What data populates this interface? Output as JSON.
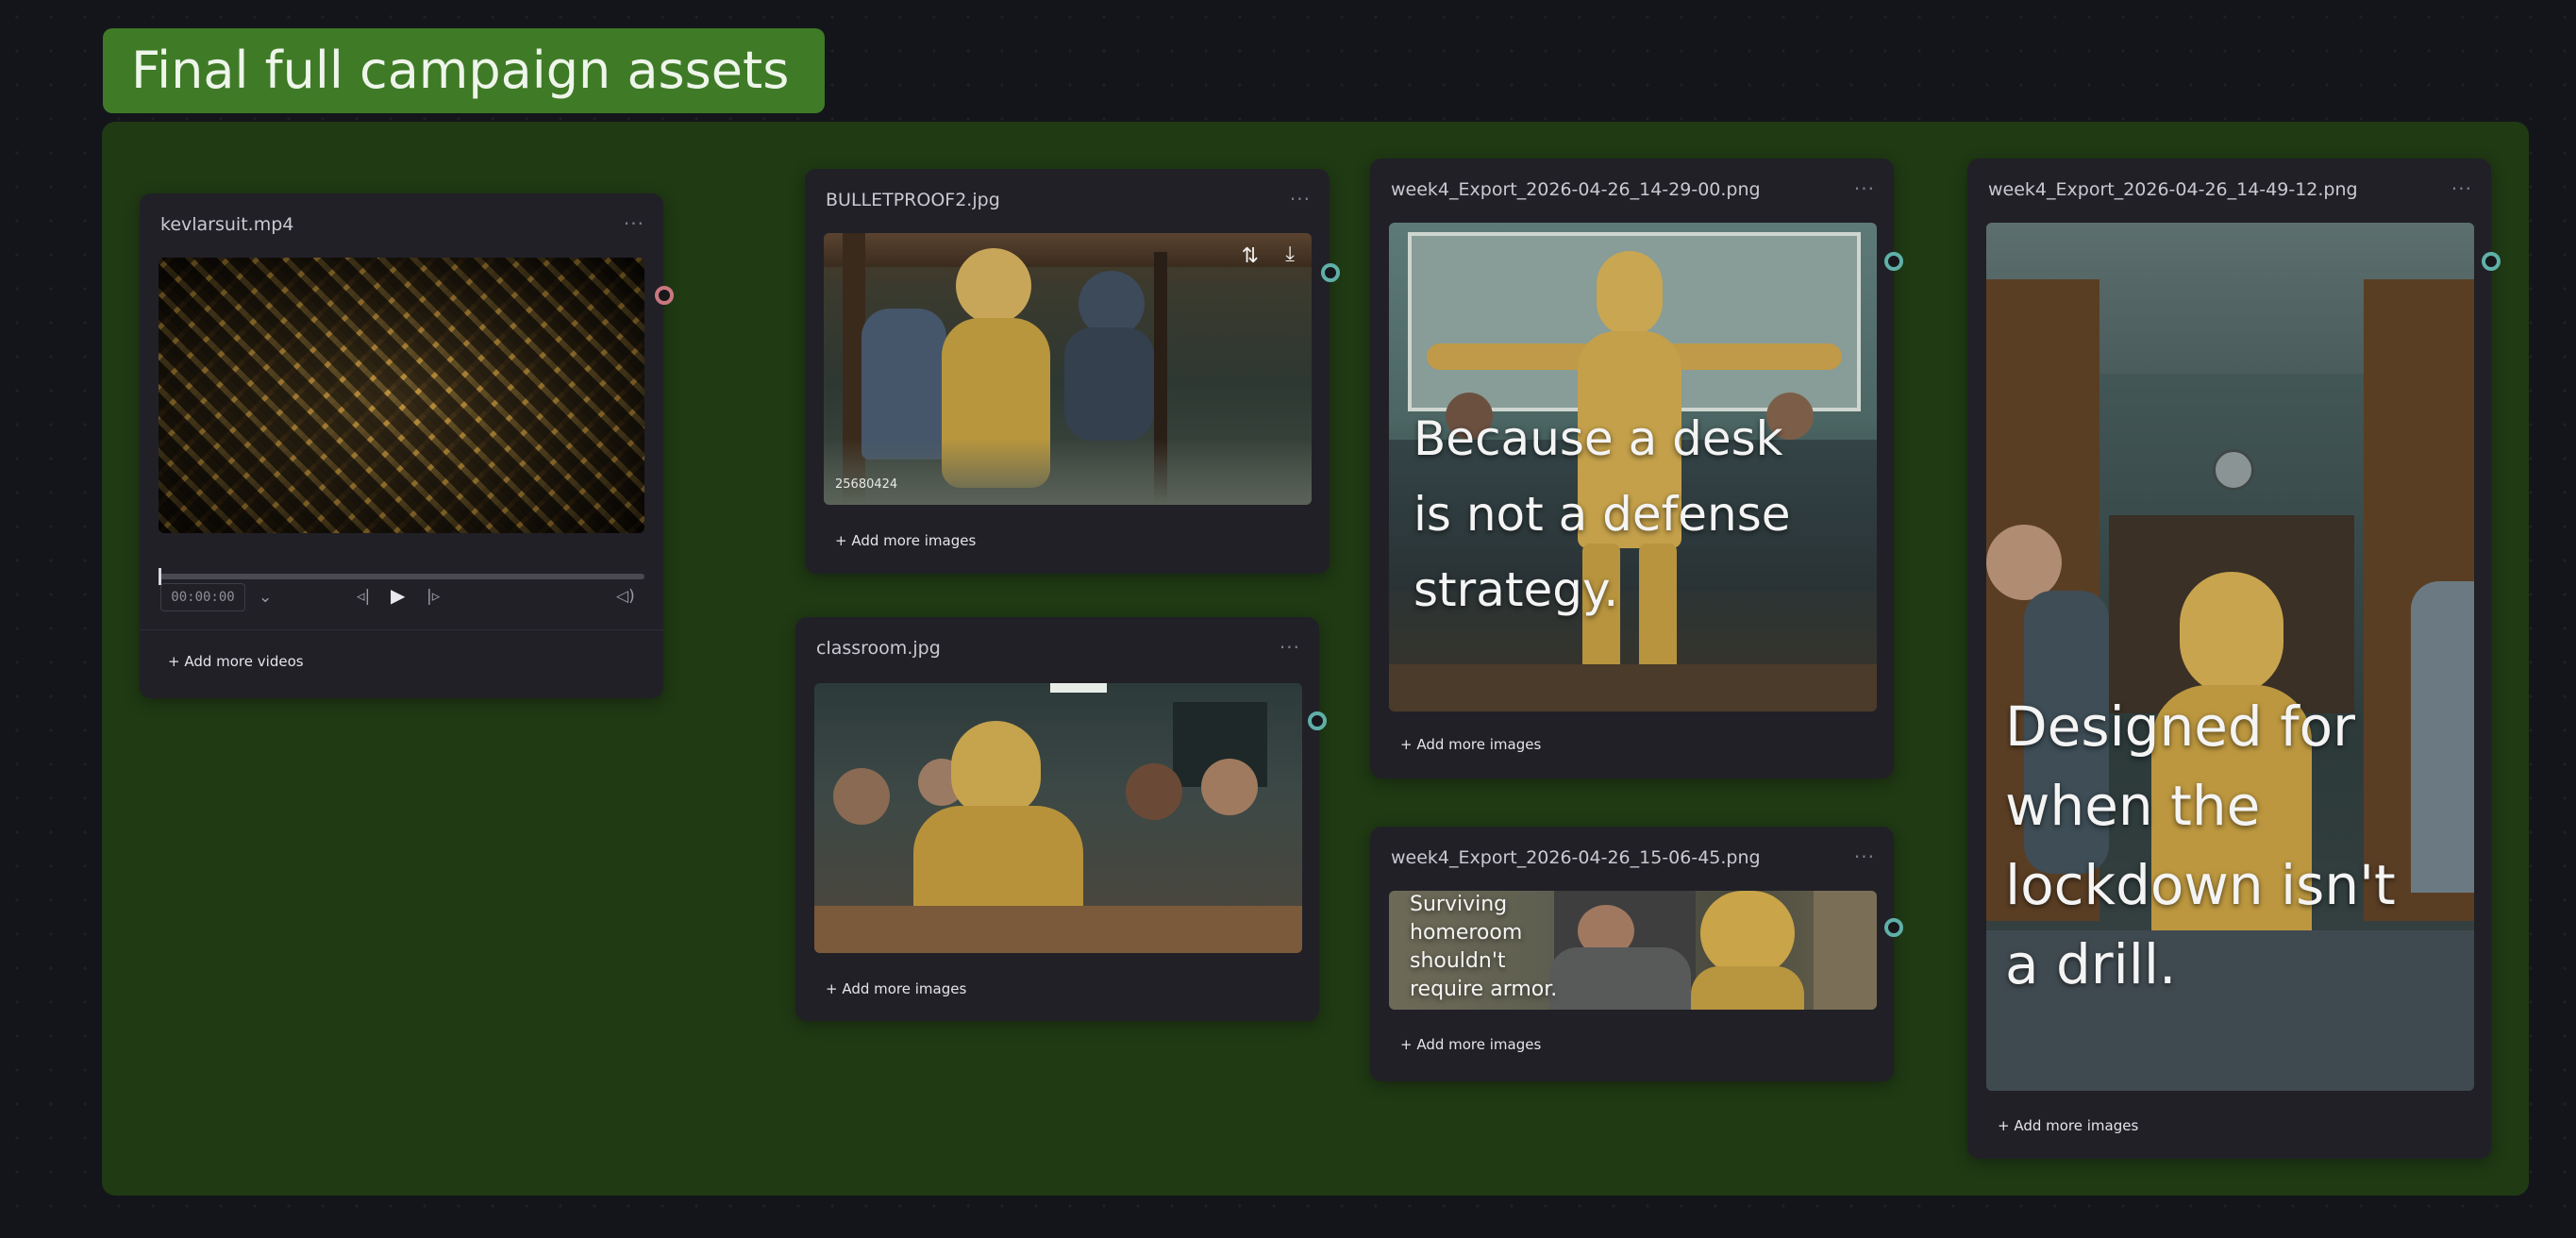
{
  "group": {
    "title": "Final full campaign assets"
  },
  "nodes": {
    "video": {
      "title": "kevlarsuit.mp4",
      "menu": "···",
      "time": "00:00:00",
      "add_more": "+ Add more videos"
    },
    "bulletproof": {
      "title": "BULLETPROOF2.jpg",
      "menu": "···",
      "image_tag": "25680424",
      "add_more": "+ Add more images"
    },
    "classroom": {
      "title": "classroom.jpg",
      "menu": "···",
      "add_more": "+ Add more images"
    },
    "export1": {
      "title": "week4_Export_2026-04-26_14-29-00.png",
      "menu": "···",
      "overlay": [
        "Because a desk",
        "is not a defense",
        "strategy."
      ],
      "add_more": "+ Add more images"
    },
    "export2": {
      "title": "week4_Export_2026-04-26_15-06-45.png",
      "menu": "···",
      "overlay": [
        "Surviving",
        "homeroom",
        "shouldn't",
        "require armor."
      ],
      "add_more": "+ Add more images"
    },
    "export3": {
      "title": "week4_Export_2026-04-26_14-49-12.png",
      "menu": "···",
      "overlay": [
        "Designed for",
        "when the",
        "lockdown isn't",
        "a drill."
      ],
      "add_more": "+ Add more images"
    }
  },
  "colors": {
    "canvas": "#14151b",
    "group_bg": "#203a14",
    "group_label": "#3f7a27",
    "node_bg": "#212027",
    "port_teal": "#5fb0a8",
    "port_pink": "#c9787f"
  }
}
